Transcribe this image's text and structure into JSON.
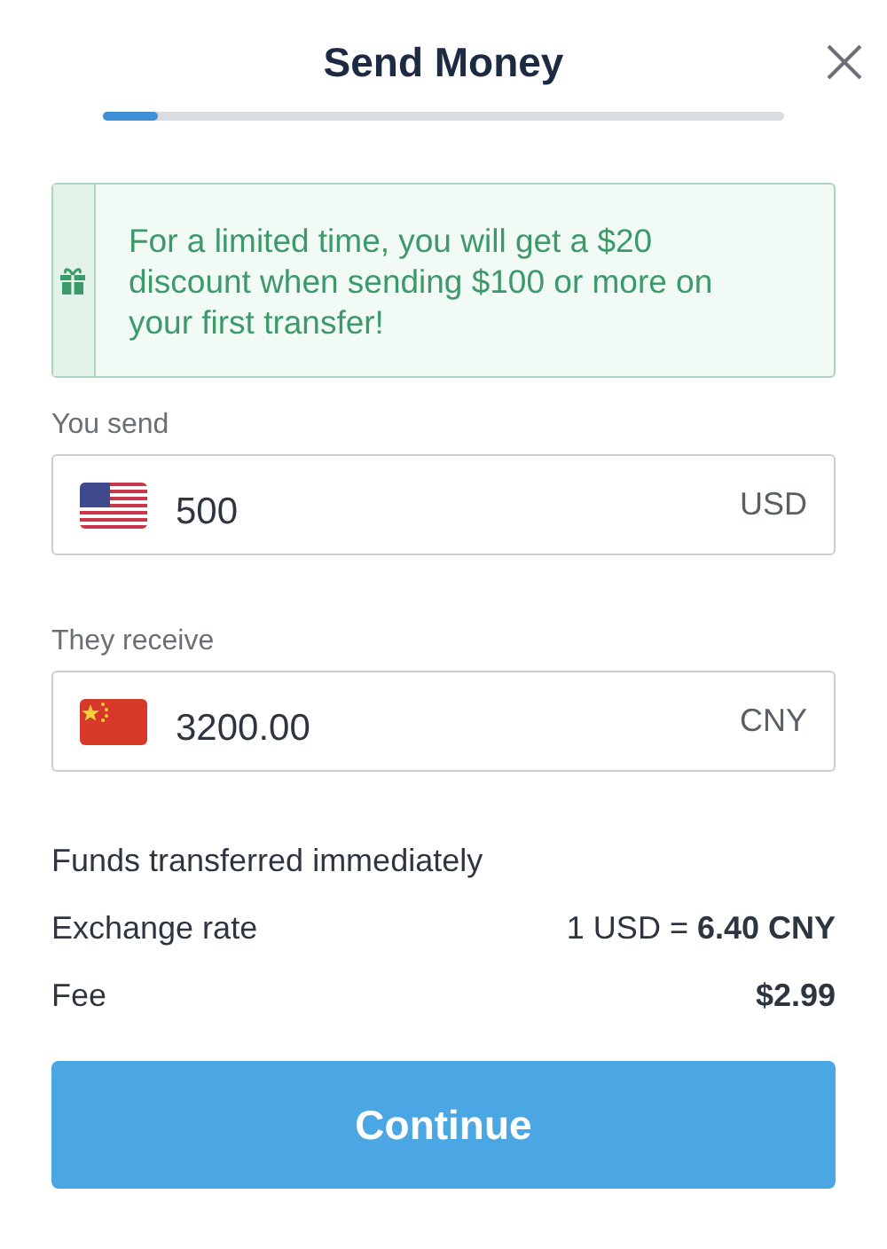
{
  "header": {
    "title": "Send Money",
    "progress": {
      "level": 0.08
    }
  },
  "promo": {
    "text": "For a limited time, you will get a $20 discount when sending $100 or more on your first transfer!"
  },
  "amounts": [
    {
      "label": "You send",
      "flag": {
        "kind": "us"
      },
      "value": "500",
      "currency": "USD"
    },
    {
      "label": "They receive",
      "flag": {
        "kind": "cn"
      },
      "value": "3200.00",
      "currency": "CNY"
    }
  ],
  "details": [
    {
      "kind": "note",
      "label": "Funds transferred immediately"
    },
    {
      "kind": "pair",
      "label": "Exchange rate",
      "value": "1 USD = **6.40 CNY**"
    },
    {
      "kind": "pair_bold",
      "label": "Fee",
      "value": "$2.99"
    }
  ],
  "continue_button": "Continue"
}
